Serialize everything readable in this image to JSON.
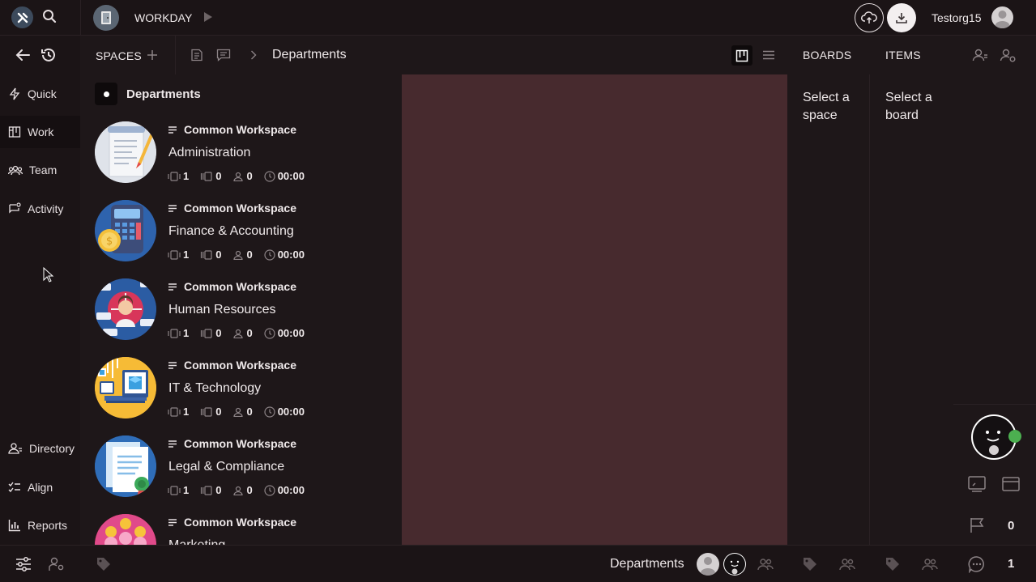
{
  "topbar": {
    "app_name": "WORKDAY",
    "username": "Testorg15"
  },
  "nav": {
    "items": [
      {
        "label": "Quick",
        "icon": "lightning-icon"
      },
      {
        "label": "Work",
        "icon": "board-icon"
      },
      {
        "label": "Team",
        "icon": "team-icon"
      },
      {
        "label": "Activity",
        "icon": "activity-icon"
      }
    ],
    "bottom_items": [
      {
        "label": "Directory",
        "icon": "directory-icon"
      },
      {
        "label": "Align",
        "icon": "align-icon"
      },
      {
        "label": "Reports",
        "icon": "reports-icon"
      }
    ]
  },
  "spaces": {
    "header_label": "SPACES",
    "breadcrumb_current": "Departments",
    "group_title": "Departments",
    "items": [
      {
        "workspace": "Common Workspace",
        "name": "Administration",
        "boards": "1",
        "items": "0",
        "members": "0",
        "time": "00:00"
      },
      {
        "workspace": "Common Workspace",
        "name": "Finance & Accounting",
        "boards": "1",
        "items": "0",
        "members": "0",
        "time": "00:00"
      },
      {
        "workspace": "Common Workspace",
        "name": "Human Resources",
        "boards": "1",
        "items": "0",
        "members": "0",
        "time": "00:00"
      },
      {
        "workspace": "Common Workspace",
        "name": "IT & Technology",
        "boards": "1",
        "items": "0",
        "members": "0",
        "time": "00:00"
      },
      {
        "workspace": "Common Workspace",
        "name": "Legal & Compliance",
        "boards": "1",
        "items": "0",
        "members": "0",
        "time": "00:00"
      },
      {
        "workspace": "Common Workspace",
        "name": "Marketing",
        "boards": "",
        "items": "",
        "members": "",
        "time": ""
      }
    ]
  },
  "boards": {
    "header_label": "BOARDS",
    "empty_text": "Select a space"
  },
  "items_panel": {
    "header_label": "ITEMS",
    "empty_text": "Select a board"
  },
  "right_rail": {
    "flag_count": "0"
  },
  "bottombar": {
    "context_label": "Departments",
    "chat_count": "1"
  },
  "colors": {
    "accent_preview": "#472a2e",
    "background": "#1e1719",
    "online_dot": "#4caf50"
  }
}
